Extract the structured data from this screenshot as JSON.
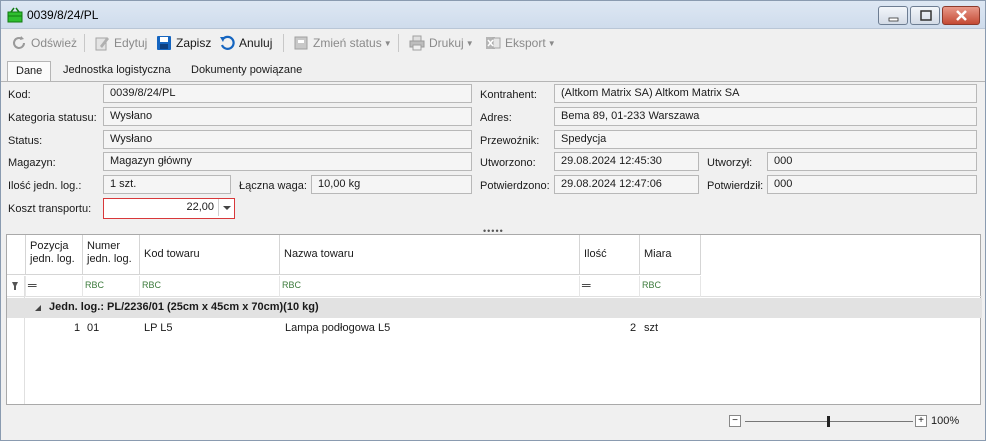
{
  "window": {
    "title": "0039/8/24/PL"
  },
  "toolbar": {
    "refresh": "Odśwież",
    "edit": "Edytuj",
    "save": "Zapisz",
    "cancel": "Anuluj",
    "change_status": "Zmień status",
    "print": "Drukuj",
    "export": "Eksport"
  },
  "tabs": [
    "Dane",
    "Jednostka logistyczna",
    "Dokumenty powiązane"
  ],
  "form": {
    "kod_label": "Kod:",
    "kod": "0039/8/24/PL",
    "kategoria_label": "Kategoria statusu:",
    "kategoria": "Wysłano",
    "status_label": "Status:",
    "status": "Wysłano",
    "magazyn_label": "Magazyn:",
    "magazyn": "Magazyn główny",
    "ilosc_label": "Ilość jedn. log.:",
    "ilosc": "1 szt.",
    "waga_label": "Łączna waga:",
    "waga": "10,00 kg",
    "koszt_label": "Koszt transportu:",
    "koszt": "22,00",
    "kontrahent_label": "Kontrahent:",
    "kontrahent": "(Altkom Matrix SA) Altkom Matrix SA",
    "adres_label": "Adres:",
    "adres": "Bema 89, 01-233 Warszawa",
    "przewoznik_label": "Przewoźnik:",
    "przewoznik": "Spedycja",
    "utworzono_label": "Utworzono:",
    "utworzono": "29.08.2024 12:45:30",
    "utworzyl_label": "Utworzył:",
    "utworzyl": "000",
    "potwierdzono_label": "Potwierdzono:",
    "potwierdzono": "29.08.2024 12:47:06",
    "potwierdzil_label": "Potwierdził:",
    "potwierdzil": "000"
  },
  "grid": {
    "headers": {
      "pozycja": "Pozycja jedn. log.",
      "numer": "Numer jedn. log.",
      "kod": "Kod towaru",
      "nazwa": "Nazwa towaru",
      "ilosc": "Ilość",
      "miara": "Miara"
    },
    "filter_text": "RBC",
    "group_row": "Jedn. log.: PL/2236/01 (25cm x 45cm x 70cm)(10 kg)",
    "rows": [
      {
        "pozycja": "1",
        "numer": "01",
        "kod": "LP L5",
        "nazwa": "Lampa podłogowa L5",
        "ilosc": "2",
        "miara": "szt"
      }
    ]
  },
  "zoom": {
    "label": "100%",
    "level_percent": 100
  },
  "colors": {
    "accent": "#1565c0",
    "required_border": "#d8383a"
  }
}
